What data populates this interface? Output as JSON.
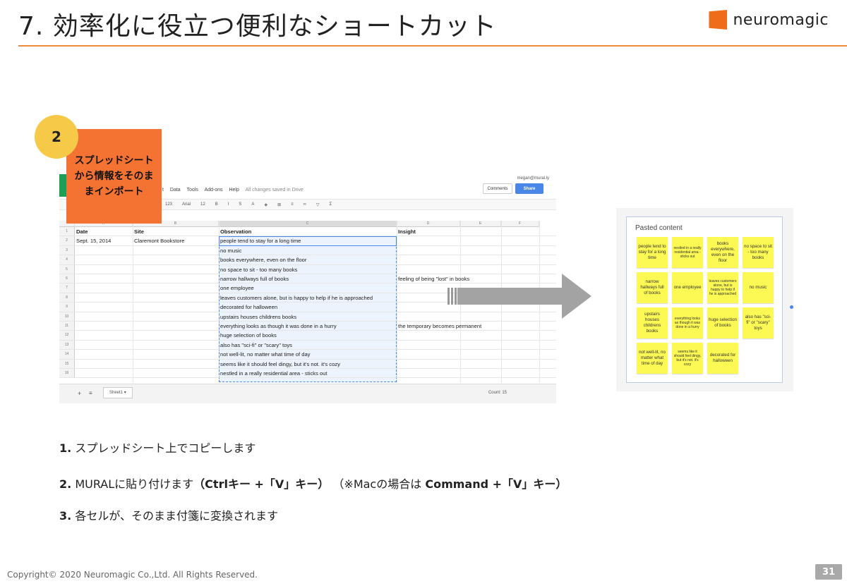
{
  "header": {
    "title": "7. 効率化に役立つ便利なショートカット",
    "brand": "neuromagic",
    "brand_color": "#ef6c1a"
  },
  "step_badge": {
    "number": "2",
    "label": "スプレッドシートから情報をそのままインポート"
  },
  "spreadsheet": {
    "menu": [
      "t",
      "Data",
      "Tools",
      "Add-ons",
      "Help"
    ],
    "saved_status": "All changes saved in Drive",
    "user_email": "megan@mural.ly",
    "comments_label": "Comments",
    "share_label": "Share",
    "font_name": "Arial",
    "font_size": "12",
    "number_format": "123",
    "column_letters": [
      "A",
      "B",
      "C",
      "D",
      "E",
      "F"
    ],
    "headers": [
      "Date",
      "Site",
      "Observation",
      "Insight"
    ],
    "rows": [
      {
        "n": "2",
        "date": "Sept. 15, 2014",
        "site": "Claremont Bookstore",
        "observation": "people tend to stay for a long time",
        "insight": ""
      },
      {
        "n": "3",
        "date": "",
        "site": "",
        "observation": "no music",
        "insight": ""
      },
      {
        "n": "4",
        "date": "",
        "site": "",
        "observation": "books everywhere, even on the floor",
        "insight": ""
      },
      {
        "n": "5",
        "date": "",
        "site": "",
        "observation": "no space to sit - too many books",
        "insight": ""
      },
      {
        "n": "6",
        "date": "",
        "site": "",
        "observation": "narrow hallways full of books",
        "insight": "feeling of being \"lost\" in books"
      },
      {
        "n": "7",
        "date": "",
        "site": "",
        "observation": "one employee",
        "insight": ""
      },
      {
        "n": "8",
        "date": "",
        "site": "",
        "observation": "leaves customers alone, but is happy to help if he is approached",
        "insight": ""
      },
      {
        "n": "9",
        "date": "",
        "site": "",
        "observation": "decorated for halloween",
        "insight": ""
      },
      {
        "n": "10",
        "date": "",
        "site": "",
        "observation": "upstairs houses childrens books",
        "insight": ""
      },
      {
        "n": "11",
        "date": "",
        "site": "",
        "observation": "everything looks as though it was done in a hurry",
        "insight": "the temporary becomes permanent"
      },
      {
        "n": "12",
        "date": "",
        "site": "",
        "observation": "huge selection of books",
        "insight": ""
      },
      {
        "n": "13",
        "date": "",
        "site": "",
        "observation": "also has \"sci-fi\" or \"scary\" toys",
        "insight": ""
      },
      {
        "n": "14",
        "date": "",
        "site": "",
        "observation": "not well-lit, no matter what time of day",
        "insight": ""
      },
      {
        "n": "15",
        "date": "",
        "site": "",
        "observation": "seems like it should feel dingy, but it's not. it's cozy",
        "insight": ""
      },
      {
        "n": "16",
        "date": "",
        "site": "",
        "observation": "nestled in a really residential area - sticks out",
        "insight": ""
      }
    ],
    "sheet_tab": "Sheet1",
    "count_label": "Count: 15"
  },
  "mural": {
    "panel_title": "Pasted content",
    "sticky_color": "#fcf854",
    "stickies": [
      "people tend to stay for a long time",
      "nestled in a really residential area - sticks out",
      "books everywhere, even on the floor",
      "no space to sit - too many books",
      "narrow hallways full of books",
      "one employee",
      "leaves customers alone, but is happy to help if he is approached",
      "no music",
      "upstairs houses childrens books",
      "everything looks as though it was done in a hurry",
      "huge selection of books",
      "also has \"sci-fi\" or \"scary\" toys",
      "not well-lit, no matter what time of day",
      "seems like it should feel dingy, but it's not. it's cozy",
      "decorated for halloween"
    ]
  },
  "steps": [
    {
      "num": "1.",
      "text": "スプレッドシート上でコピーします"
    },
    {
      "num": "2.",
      "text_pre": "MURALに貼り付けます",
      "text_bold": "（Ctrlキー +「V」キー）",
      "text_post": "（※Macの場合は",
      "text_bold2": "Command +「V」キー）"
    },
    {
      "num": "3.",
      "text": "各セルが、そのまま付箋に変換されます"
    }
  ],
  "footer": {
    "copyright": "Copyright© 2020 Neuromagic Co.,Ltd. All Rights Reserved.",
    "page_number": "31"
  }
}
